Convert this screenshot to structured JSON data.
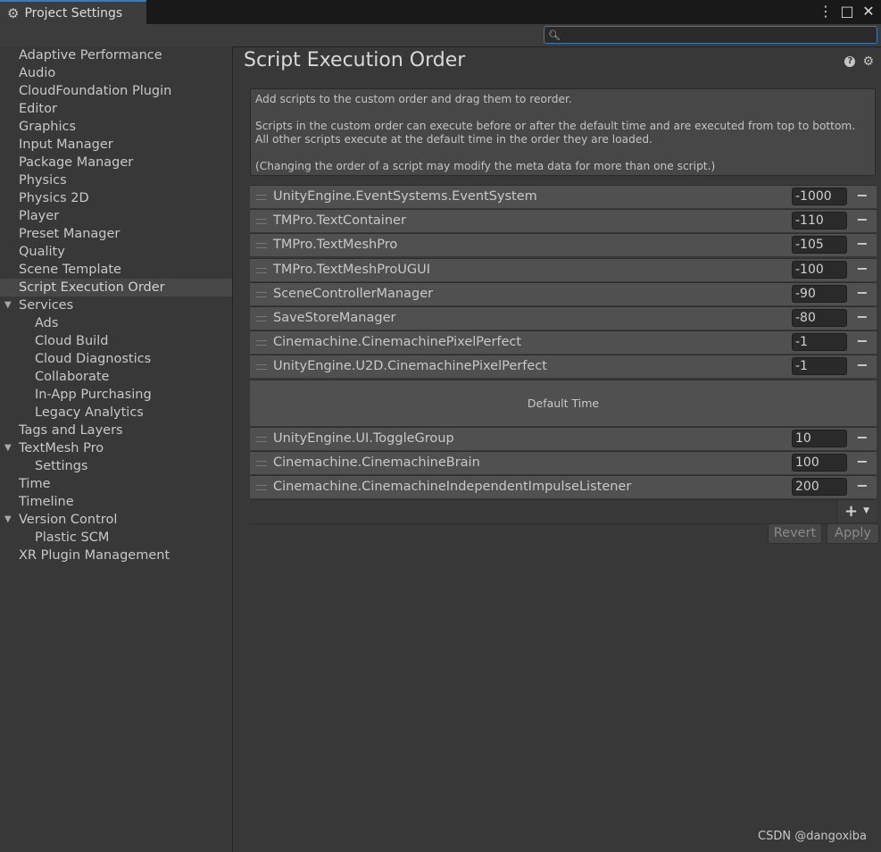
{
  "window": {
    "tab_title": "Project Settings",
    "controls": [
      "⋮",
      "□",
      "✕"
    ]
  },
  "search": {
    "value": "",
    "placeholder": ""
  },
  "sidebar": {
    "items": [
      {
        "label": "Adaptive Performance",
        "level": 0
      },
      {
        "label": "Audio",
        "level": 0
      },
      {
        "label": "CloudFoundation Plugin",
        "level": 0
      },
      {
        "label": "Editor",
        "level": 0
      },
      {
        "label": "Graphics",
        "level": 0
      },
      {
        "label": "Input Manager",
        "level": 0
      },
      {
        "label": "Package Manager",
        "level": 0
      },
      {
        "label": "Physics",
        "level": 0
      },
      {
        "label": "Physics 2D",
        "level": 0
      },
      {
        "label": "Player",
        "level": 0
      },
      {
        "label": "Preset Manager",
        "level": 0
      },
      {
        "label": "Quality",
        "level": 0
      },
      {
        "label": "Scene Template",
        "level": 0
      },
      {
        "label": "Script Execution Order",
        "level": 0,
        "selected": true
      },
      {
        "label": "Services",
        "level": 0,
        "expanded": true
      },
      {
        "label": "Ads",
        "level": 1
      },
      {
        "label": "Cloud Build",
        "level": 1
      },
      {
        "label": "Cloud Diagnostics",
        "level": 1
      },
      {
        "label": "Collaborate",
        "level": 1
      },
      {
        "label": "In-App Purchasing",
        "level": 1
      },
      {
        "label": "Legacy Analytics",
        "level": 1
      },
      {
        "label": "Tags and Layers",
        "level": 0
      },
      {
        "label": "TextMesh Pro",
        "level": 0,
        "expanded": true
      },
      {
        "label": "Settings",
        "level": 1
      },
      {
        "label": "Time",
        "level": 0
      },
      {
        "label": "Timeline",
        "level": 0
      },
      {
        "label": "Version Control",
        "level": 0,
        "expanded": true
      },
      {
        "label": "Plastic SCM",
        "level": 1
      },
      {
        "label": "XR Plugin Management",
        "level": 0
      }
    ]
  },
  "main": {
    "title": "Script Execution Order",
    "info": {
      "line1": "Add scripts to the custom order and drag them to reorder.",
      "line2": "Scripts in the custom order can execute before or after the default time and are executed from top to bottom. All other scripts execute at the default time in the order they are loaded.",
      "line3": "(Changing the order of a script may modify the meta data for more than one script.)"
    },
    "scripts_before": [
      {
        "name": "UnityEngine.EventSystems.EventSystem",
        "order": "-1000"
      },
      {
        "name": "TMPro.TextContainer",
        "order": "-110"
      },
      {
        "name": "TMPro.TextMeshPro",
        "order": "-105"
      },
      {
        "name": "TMPro.TextMeshProUGUI",
        "order": "-100"
      },
      {
        "name": "SceneControllerManager",
        "order": "-90"
      },
      {
        "name": "SaveStoreManager",
        "order": "-80"
      },
      {
        "name": "Cinemachine.CinemachinePixelPerfect",
        "order": "-1"
      },
      {
        "name": "UnityEngine.U2D.CinemachinePixelPerfect",
        "order": "-1"
      }
    ],
    "default_time_label": "Default Time",
    "scripts_after": [
      {
        "name": "UnityEngine.UI.ToggleGroup",
        "order": "10"
      },
      {
        "name": "Cinemachine.CinemachineBrain",
        "order": "100"
      },
      {
        "name": "Cinemachine.CinemachineIndependentImpulseListener",
        "order": "200"
      }
    ],
    "remove_glyph": "−",
    "add_glyph": "+",
    "add_dropdown_glyph": "▼",
    "revert_label": "Revert",
    "apply_label": "Apply"
  },
  "watermark": "CSDN @dangoxiba",
  "colors": {
    "background": "#383838",
    "accent": "#3a79bb",
    "row": "#505050",
    "selected": "#474747"
  }
}
